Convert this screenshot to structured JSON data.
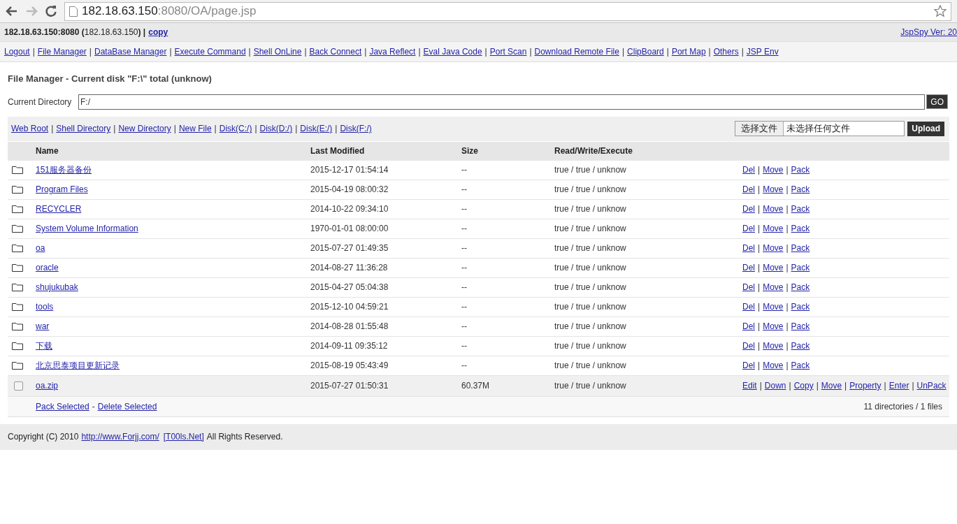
{
  "browser": {
    "url_host": "182.18.63.150",
    "url_path": ":8080/OA/page.jsp"
  },
  "info_bar": {
    "host": "**182.18.63.150:8080 (**182.18.63.150**) |**",
    "copy_link": "copy",
    "version": "JspSpy Ver: 20"
  },
  "link_separator": "|",
  "nav_links": [
    "Logout",
    "File Manager",
    "DataBase Manager",
    "Execute Command",
    "Shell OnLine",
    "Back Connect",
    "Java Reflect",
    "Eval Java Code",
    "Port Scan",
    "Download Remote File",
    "ClipBoard",
    "Port Map",
    "Others",
    "JSP Env"
  ],
  "title": "File Manager - Current disk \"F:\\\" total (unknow)",
  "directory": {
    "label": "Current Directory",
    "value": "F:/",
    "button": "GO"
  },
  "tool_links": [
    "Web Root",
    "Shell Directory",
    "New Directory",
    "New File",
    "Disk(C:/)",
    "Disk(D:/)",
    "Disk(E:/)",
    "Disk(F:/)"
  ],
  "upload": {
    "choose_button": "选择文件",
    "status": "未选择任何文件",
    "button": "Upload"
  },
  "table": {
    "columns": [
      "Name",
      "Last Modified",
      "Size",
      "Read/Write/Execute"
    ],
    "rows": [
      {
        "kind": "dir",
        "name": "151服务器备份",
        "modified": "2015-12-17 01:54:14",
        "size": "--",
        "rwe": "true / true / unknow",
        "actions": [
          "Del",
          "Move",
          "Pack"
        ]
      },
      {
        "kind": "dir",
        "name": "Program Files",
        "modified": "2015-04-19 08:00:32",
        "size": "--",
        "rwe": "true / true / unknow",
        "actions": [
          "Del",
          "Move",
          "Pack"
        ]
      },
      {
        "kind": "dir",
        "name": "RECYCLER",
        "modified": "2014-10-22 09:34:10",
        "size": "--",
        "rwe": "true / true / unknow",
        "actions": [
          "Del",
          "Move",
          "Pack"
        ]
      },
      {
        "kind": "dir",
        "name": "System Volume Information",
        "modified": "1970-01-01 08:00:00",
        "size": "--",
        "rwe": "true / true / unknow",
        "actions": [
          "Del",
          "Move",
          "Pack"
        ]
      },
      {
        "kind": "dir",
        "name": "oa",
        "modified": "2015-07-27 01:49:35",
        "size": "--",
        "rwe": "true / true / unknow",
        "actions": [
          "Del",
          "Move",
          "Pack"
        ]
      },
      {
        "kind": "dir",
        "name": "oracle",
        "modified": "2014-08-27 11:36:28",
        "size": "--",
        "rwe": "true / true / unknow",
        "actions": [
          "Del",
          "Move",
          "Pack"
        ]
      },
      {
        "kind": "dir",
        "name": "shujukubak",
        "modified": "2015-04-27 05:04:38",
        "size": "--",
        "rwe": "true / true / unknow",
        "actions": [
          "Del",
          "Move",
          "Pack"
        ]
      },
      {
        "kind": "dir",
        "name": "tools",
        "modified": "2015-12-10 04:59:21",
        "size": "--",
        "rwe": "true / true / unknow",
        "actions": [
          "Del",
          "Move",
          "Pack"
        ]
      },
      {
        "kind": "dir",
        "name": "war",
        "modified": "2014-08-28 01:55:48",
        "size": "--",
        "rwe": "true / true / unknow",
        "actions": [
          "Del",
          "Move",
          "Pack"
        ]
      },
      {
        "kind": "dir",
        "name": "下载",
        "modified": "2014-09-11 09:35:12",
        "size": "--",
        "rwe": "true / true / unknow",
        "actions": [
          "Del",
          "Move",
          "Pack"
        ]
      },
      {
        "kind": "dir",
        "name": "北京思泰项目更新记录",
        "modified": "2015-08-19 05:43:49",
        "size": "--",
        "rwe": "true / true / unknow",
        "actions": [
          "Del",
          "Move",
          "Pack"
        ]
      },
      {
        "kind": "file",
        "checked": false,
        "name": "oa.zip",
        "modified": "2015-07-27 01:50:31",
        "size": "60.37M",
        "rwe": "true / true / unknow",
        "actions": [
          "Edit",
          "Down",
          "Copy",
          "Move",
          "Property",
          "Enter",
          "UnPack"
        ]
      }
    ],
    "footer": {
      "pack_link": "Pack Selected",
      "separator": "-",
      "delete_link": "Delete Selected",
      "summary": "11 directories / 1 files"
    }
  },
  "copyright": {
    "before": "Copyright (C) 2010",
    "link": "http://www.Forjj.com/",
    "tools_link": "[T00ls.Net]",
    "after": "All Rights Reserved."
  }
}
